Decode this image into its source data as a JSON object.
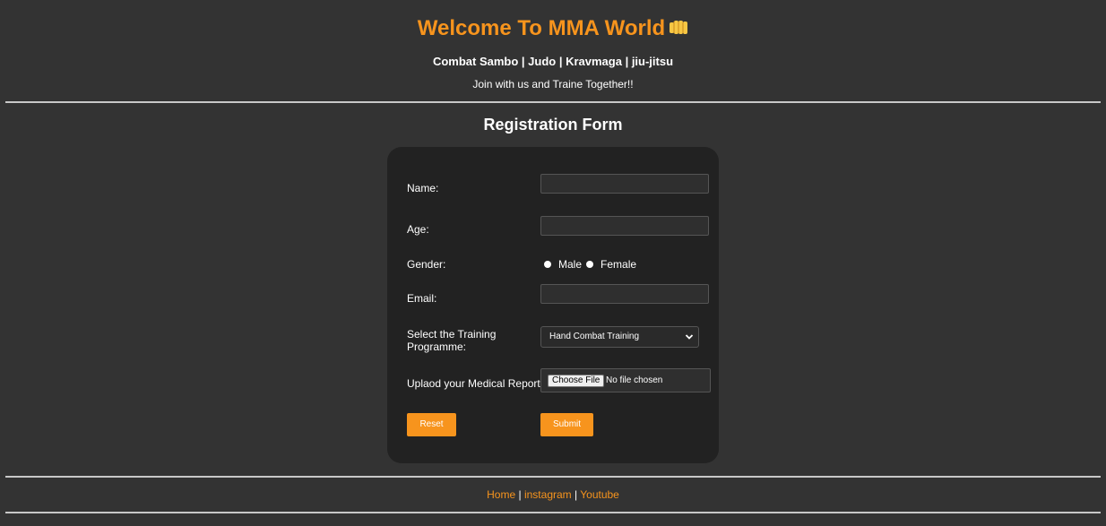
{
  "header": {
    "title": "Welcome To MMA World",
    "disciplines": "Combat Sambo | Judo | Kravmaga | jiu-jitsu",
    "tagline": "Join with us and Traine Together!!"
  },
  "form": {
    "heading": "Registration Form",
    "name_label": "Name:",
    "name_value": "",
    "age_label": "Age:",
    "age_value": "",
    "gender_label": "Gender:",
    "gender_options": [
      "Male",
      "Female"
    ],
    "email_label": "Email:",
    "email_value": "",
    "training_label": "Select the Training Programme:",
    "training_selected": "Hand Combat Training",
    "upload_label": "Uplaod your Medical Report:",
    "file_button_label": "Choose File",
    "file_status": "No file chosen",
    "reset_label": "Reset",
    "submit_label": "Submit"
  },
  "footer": {
    "links": [
      "Home",
      "instagram",
      "Youtube"
    ],
    "separator": "|"
  },
  "colors": {
    "background": "#333333",
    "card": "#222222",
    "accent": "#f7941d",
    "text": "#ffffff"
  },
  "icons": {
    "title_icon": "fist-icon",
    "select_icon": "chevron-down-icon"
  }
}
